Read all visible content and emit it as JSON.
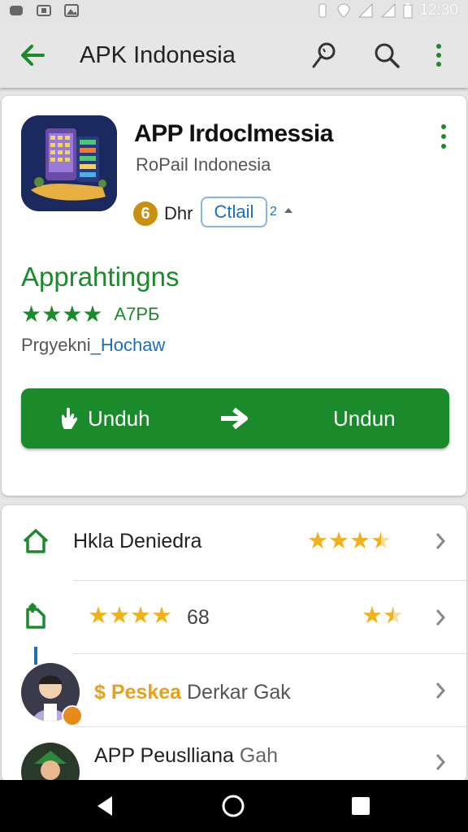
{
  "status_bar": {
    "time": "12:30"
  },
  "app_bar": {
    "title": "APK Indonesia",
    "back_icon": "arrow-left-icon",
    "actions": [
      "pin-icon",
      "search-icon",
      "more-vert-icon"
    ]
  },
  "app": {
    "name": "APP Irdoclmessia",
    "developer": "RoPail Indonesia",
    "coin_value": "6",
    "coin_label": "Dhr",
    "chip_label": "Ctlail",
    "chip_suffix": "2"
  },
  "details": {
    "title": "Apprahtingns",
    "rating_stars": 4,
    "rating_text": "A7PБ",
    "lang_prefix": "Prgyekni",
    "lang_link": "_Hochaw"
  },
  "download_button": {
    "label_left": "Unduh",
    "label_right": "Undun"
  },
  "list": {
    "items": [
      {
        "title": "Hkla Deniedra",
        "icon": "home-icon",
        "rating": 3.5
      },
      {
        "left_rating": 4,
        "count": "68",
        "icon": "upload-icon",
        "rating": 1.5
      },
      {
        "title_accent": "$ Peskea",
        "title_rest": " Derkar Gak",
        "icon": "avatar-user"
      },
      {
        "title": "APP Peuslliana",
        "suffix": " Gah",
        "icon": "avatar-user"
      }
    ]
  },
  "colors": {
    "accent": "#1a8a2a",
    "link": "#1a6fc4",
    "star": "#f0b21a"
  }
}
